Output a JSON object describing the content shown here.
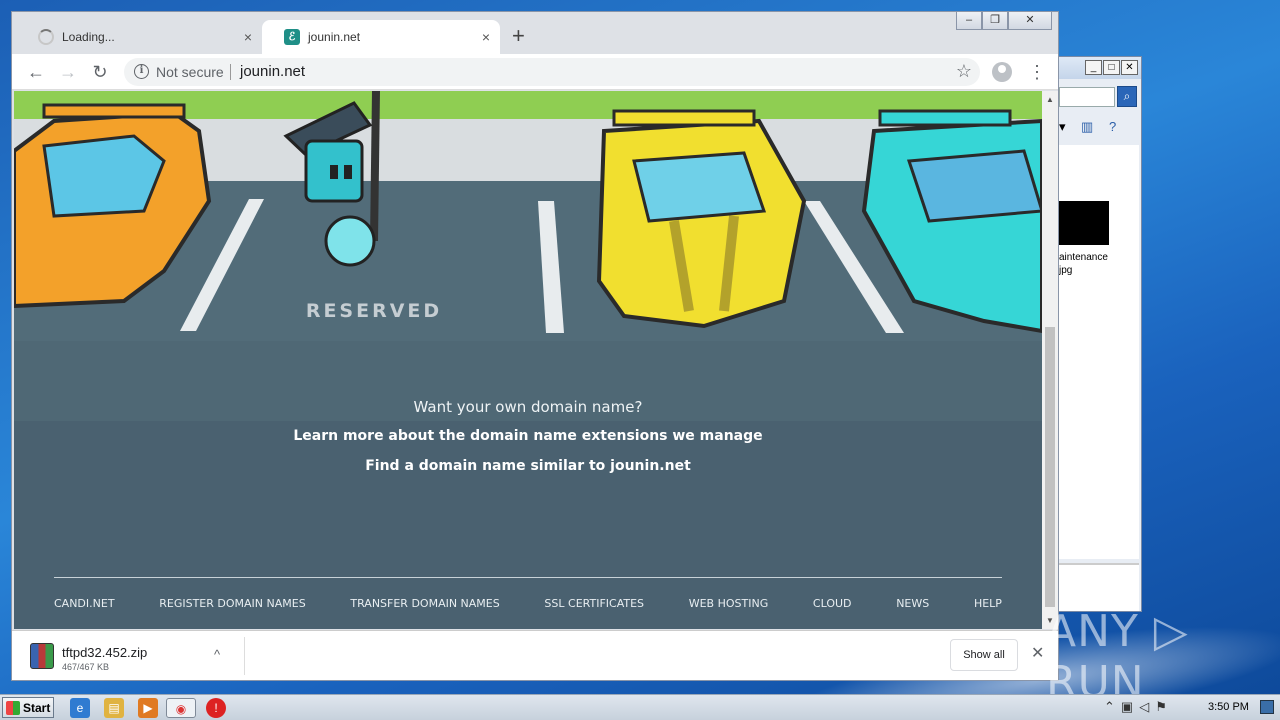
{
  "browser": {
    "tabs": [
      {
        "title": "Loading...",
        "state": "loading",
        "close_icon": "×"
      },
      {
        "title": "jounin.net",
        "state": "active",
        "close_icon": "×"
      }
    ],
    "new_tab_icon": "+",
    "window_controls": {
      "minimize": "‒",
      "restore": "❐",
      "close": "✕"
    },
    "nav": {
      "back": "←",
      "forward": "→",
      "reload": "↻"
    },
    "address": {
      "security_label": "Not secure",
      "url": "jounin.net",
      "bookmark_icon": "☆"
    },
    "menu_icon": "⋮"
  },
  "page": {
    "scene_sign": "RESERVED",
    "question": "Want your own domain name?",
    "link_extensions": "Learn more about the domain name extensions we manage",
    "link_similar": "Find a domain name similar to jounin.net",
    "footer_nav": [
      "CANDI.NET",
      "REGISTER DOMAIN NAMES",
      "TRANSFER DOMAIN NAMES",
      "SSL CERTIFICATES",
      "WEB HOSTING",
      "CLOUD",
      "NEWS",
      "HELP"
    ],
    "colors": {
      "background": "#4b6270",
      "grass": "#8fce52",
      "car_orange": "#f3a12a",
      "car_yellow": "#f1df2f",
      "car_cyan": "#36d6d6"
    }
  },
  "download": {
    "file_name": "tftpd32.452.zip",
    "progress": "467/467 KB",
    "caret": "^",
    "show_all": "Show all",
    "close_icon": "✕"
  },
  "background_window": {
    "file_label_line1": "aintenance",
    "file_label_line2": "jpg"
  },
  "watermark": "ANY ▷ RUN",
  "taskbar": {
    "start_label": "Start",
    "clock": "3:50 PM"
  }
}
